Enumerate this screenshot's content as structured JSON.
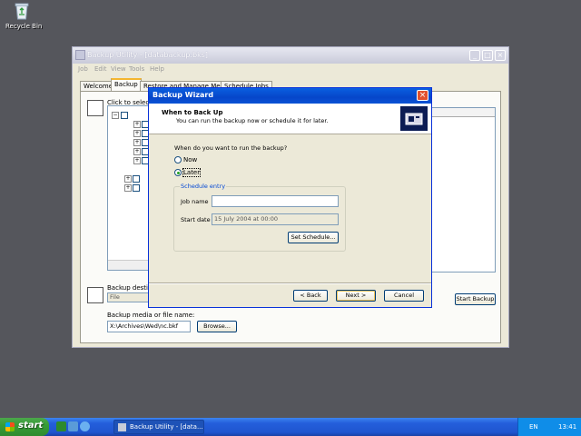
{
  "desktop": {
    "recycle_bin_label": "Recycle Bin"
  },
  "background_window": {
    "title": "Backup Utility - [databackup.bks]",
    "menu": [
      "Job",
      "Edit",
      "View",
      "Tools",
      "Help"
    ],
    "tabs": [
      "Welcome",
      "Backup",
      "Restore and Manage Media",
      "Schedule Jobs"
    ],
    "instruction_text": "Click to select th",
    "tree_root_label": "De",
    "backup_destination_label": "Backup destina",
    "destination_value": "File",
    "media_label": "Backup media or file name:",
    "media_value": "X:\\Archives\\Wed\\nc.bkf",
    "browse_label": "Browse...",
    "start_backup_label": "Start Backup"
  },
  "dialog": {
    "title": "Backup Wizard",
    "header_title": "When to Back Up",
    "header_subtitle": "You can run the backup now or schedule it for later.",
    "question": "When do you want to run the backup?",
    "option_now": "Now",
    "option_later": "Later",
    "selected_option": "Later",
    "group_label": "Schedule entry",
    "job_name_label": "Job name",
    "job_name_value": "",
    "start_date_label": "Start date",
    "start_date_value": "15 July 2004 at 00:00",
    "set_schedule_label": "Set Schedule...",
    "back_label": "< Back",
    "next_label": "Next >",
    "cancel_label": "Cancel"
  },
  "taskbar": {
    "start_label": "start",
    "task_button_label": "Backup Utility - [data...",
    "language": "EN",
    "clock": "13:41"
  },
  "colors": {
    "desktop": "#55565c",
    "title_active": "#0a5fe0",
    "taskbar": "#245edb",
    "start": "#379d37"
  }
}
